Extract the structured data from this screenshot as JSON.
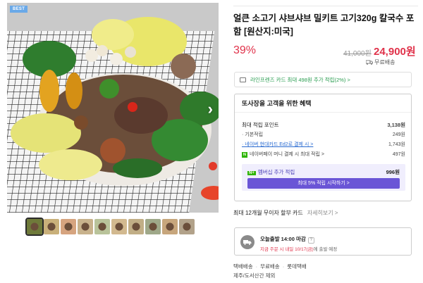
{
  "gallery": {
    "badge": "BEST",
    "thumb_count": 10,
    "thumb_colors": [
      "#6f7a3a",
      "#c9b07a",
      "#d6a47f",
      "#c8b28c",
      "#b9c39a",
      "#d2b98f",
      "#c1ae86",
      "#9fa889",
      "#c7a67c",
      "#b2a28a"
    ]
  },
  "product": {
    "title": "얼큰 소고기 샤브샤브 밀키트 고기320g 칼국수 포함 [원산지:미국]",
    "discount": "39%",
    "original_price": "41,000원",
    "sale_price": "24,900원",
    "shipping": "무료배송"
  },
  "card_promo": "라인프렌즈 카드 최대 498원 추가 적립(2%) >",
  "benefit": {
    "heading": "또사장을 고객을 위한 혜택",
    "max_points_label": "최대 적립 포인트",
    "max_points_value": "3,138원",
    "rows": [
      {
        "label": "· 기본적립",
        "value": "249원"
      },
      {
        "label": "· 네이버 현대카드 Ed2로 결제 시 >",
        "value": "1,743원"
      },
      {
        "label": "네이버페이 머니 결제 시 최대 적립 >",
        "value": "497원"
      }
    ],
    "membership_label": "멤버십 추가 적립",
    "membership_value": "996원",
    "membership_button": "최대 5% 적립 시작하기 >"
  },
  "installment": {
    "label": "최대 12개월 무이자 할부 카드",
    "more": "자세히보기 >"
  },
  "delivery": {
    "line1": "오늘출발 14:00 마감",
    "line2_red": "지금 주문 시 내일 10/17(금)",
    "line2_grey": "에 출발 예정"
  },
  "footer": {
    "items": [
      "택배배송",
      "무료배송",
      "롯데택배"
    ],
    "note": "제주/도서산간 제외"
  }
}
